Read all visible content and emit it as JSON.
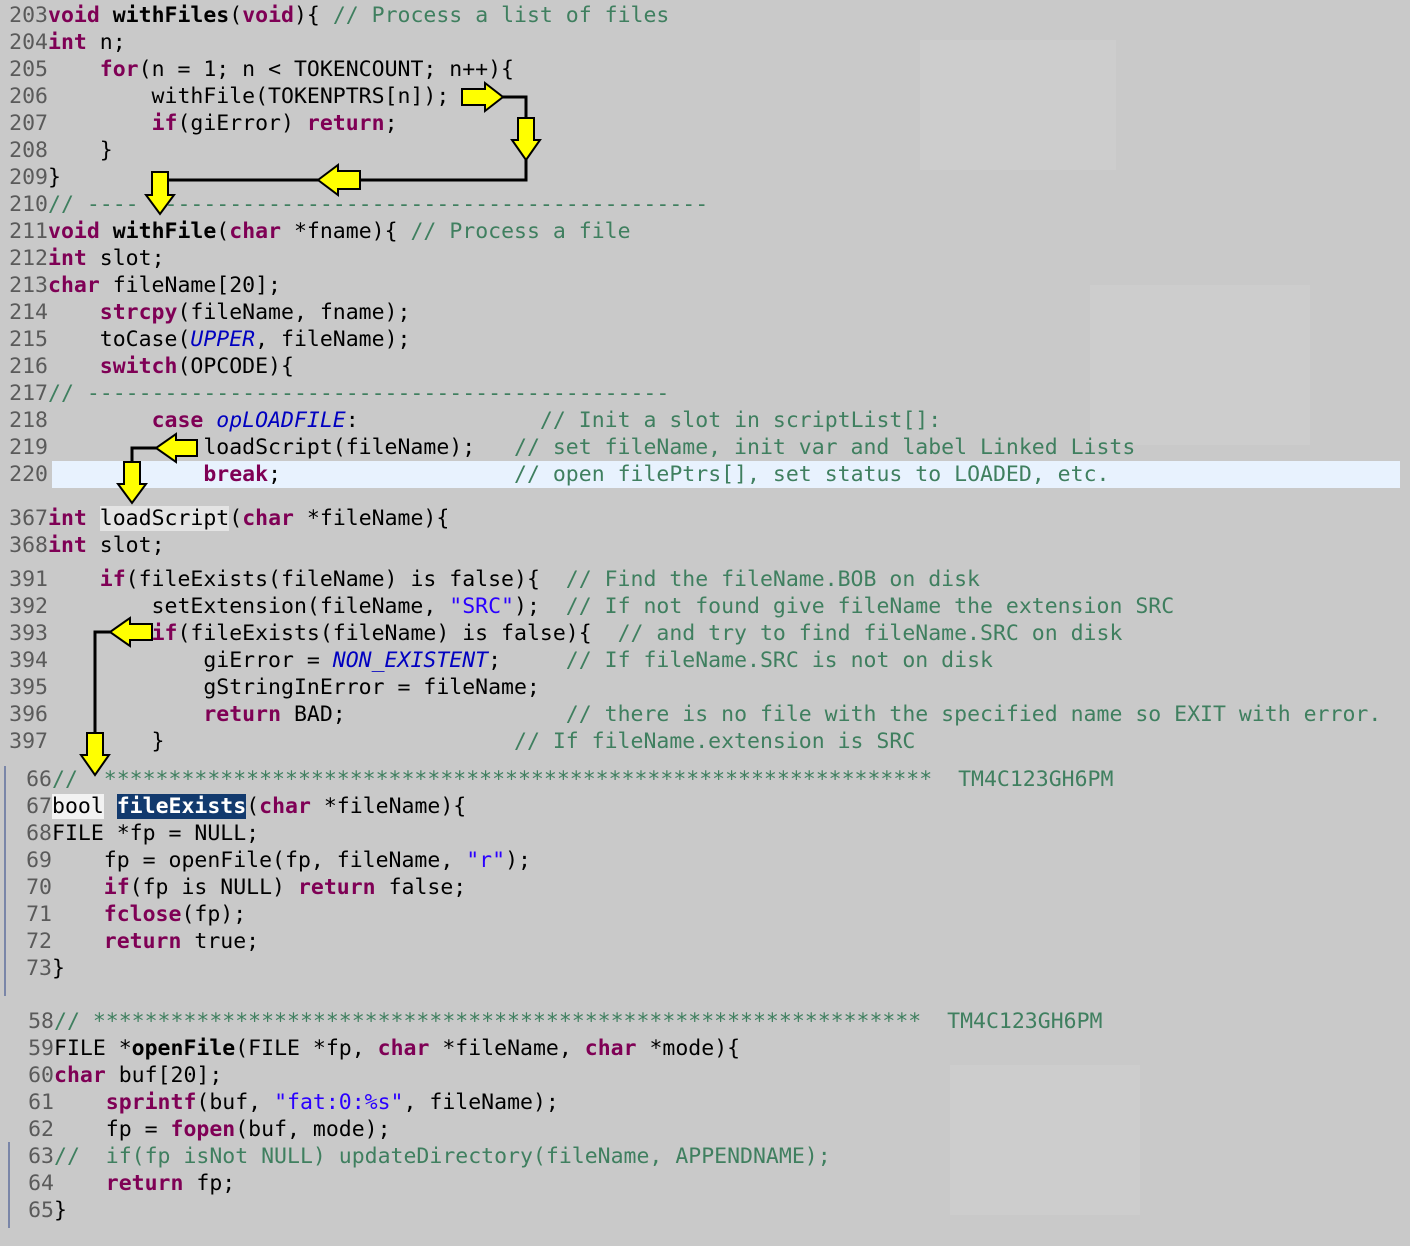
{
  "panels": {
    "withFiles": [
      {
        "n": "203",
        "t": "void withFiles(void){ // Process a list of files"
      },
      {
        "n": "204",
        "t": "int n;"
      },
      {
        "n": "205",
        "t": "    for(n = 1; n < TOKENCOUNT; n++){"
      },
      {
        "n": "206",
        "t": "        withFile(TOKENPTRS[n]);"
      },
      {
        "n": "207",
        "t": "        if(giError) return;"
      },
      {
        "n": "208",
        "t": "    }"
      },
      {
        "n": "209",
        "t": "}"
      },
      {
        "n": "210",
        "t": "// ---------------------------------------------------"
      },
      {
        "n": "211",
        "t": "void withFile(char *fname){ // Process a file"
      },
      {
        "n": "212",
        "t": "int slot;"
      },
      {
        "n": "213",
        "t": "char fileName[20];"
      },
      {
        "n": "214",
        "t": "    strcpy(fileName, fname);"
      },
      {
        "n": "215",
        "t": "    toCase(UPPER, fileName);"
      },
      {
        "n": "216",
        "t": "    switch(OPCODE){"
      },
      {
        "n": "217",
        "t": "// ---------------------------------------------"
      },
      {
        "n": "218",
        "t": "        case opLOADFILE:              // Init a slot in scriptList[]:"
      },
      {
        "n": "219",
        "t": "            loadScript(fileName);   // set fileName, init var and label Linked Lists"
      },
      {
        "n": "220",
        "t": "            break;                  // open filePtrs[], set status to LOADED, etc."
      }
    ],
    "loadScript": [
      {
        "n": "367",
        "t": "int loadScript(char *fileName){"
      },
      {
        "n": "368",
        "t": "int slot;"
      },
      {
        "n": "391",
        "t": "    if(fileExists(fileName) is false){  // Find the fileName.BOB on disk"
      },
      {
        "n": "392",
        "t": "        setExtension(fileName, \"SRC\");  // If not found give fileName the extension SRC"
      },
      {
        "n": "393",
        "t": "        if(fileExists(fileName) is false){  // and try to find fileName.SRC on disk"
      },
      {
        "n": "394",
        "t": "            giError = NON_EXISTENT;     // If fileName.SRC is not on disk"
      },
      {
        "n": "395",
        "t": "            gStringInError = fileName;"
      },
      {
        "n": "396",
        "t": "            return BAD;                 // there is no file with the specified name so EXIT with error."
      },
      {
        "n": "397",
        "t": "        }                           // If fileName.extension is SRC"
      }
    ],
    "fileExists": [
      {
        "n": "66",
        "t": "//  *****************************************************************  TM4C123GH6PM"
      },
      {
        "n": "67",
        "t": "bool fileExists(char *fileName){"
      },
      {
        "n": "68",
        "t": "FILE *fp = NULL;"
      },
      {
        "n": "69",
        "t": "    fp = openFile(fp, fileName, \"r\");"
      },
      {
        "n": "70",
        "t": "    if(fp is NULL) return false;"
      },
      {
        "n": "71",
        "t": "    fclose(fp);"
      },
      {
        "n": "72",
        "t": "    return true;"
      },
      {
        "n": "73",
        "t": "}"
      }
    ],
    "openFile": [
      {
        "n": "58",
        "t": "// *****************************************************************  TM4C123GH6PM"
      },
      {
        "n": "59",
        "t": "FILE *openFile(FILE *fp, char *fileName, char *mode){"
      },
      {
        "n": "60",
        "t": "char buf[20];"
      },
      {
        "n": "61",
        "t": "    sprintf(buf, \"fat:0:%s\", fileName);"
      },
      {
        "n": "62",
        "t": "    fp = fopen(buf, mode);"
      },
      {
        "n": "63",
        "t": "//  if(fp isNot NULL) updateDirectory(fileName, APPENDNAME);"
      },
      {
        "n": "64",
        "t": "    return fp;"
      },
      {
        "n": "65",
        "t": "}"
      }
    ]
  },
  "colors": {
    "background": "#c9c9c9",
    "keyword": "#7f0055",
    "comment": "#3f7f5f",
    "string": "#2a00ff",
    "constant": "#0000c0",
    "current_line": "#e8f2fe",
    "selection": "#123a6e",
    "arrow_fill": "#ffff00"
  }
}
